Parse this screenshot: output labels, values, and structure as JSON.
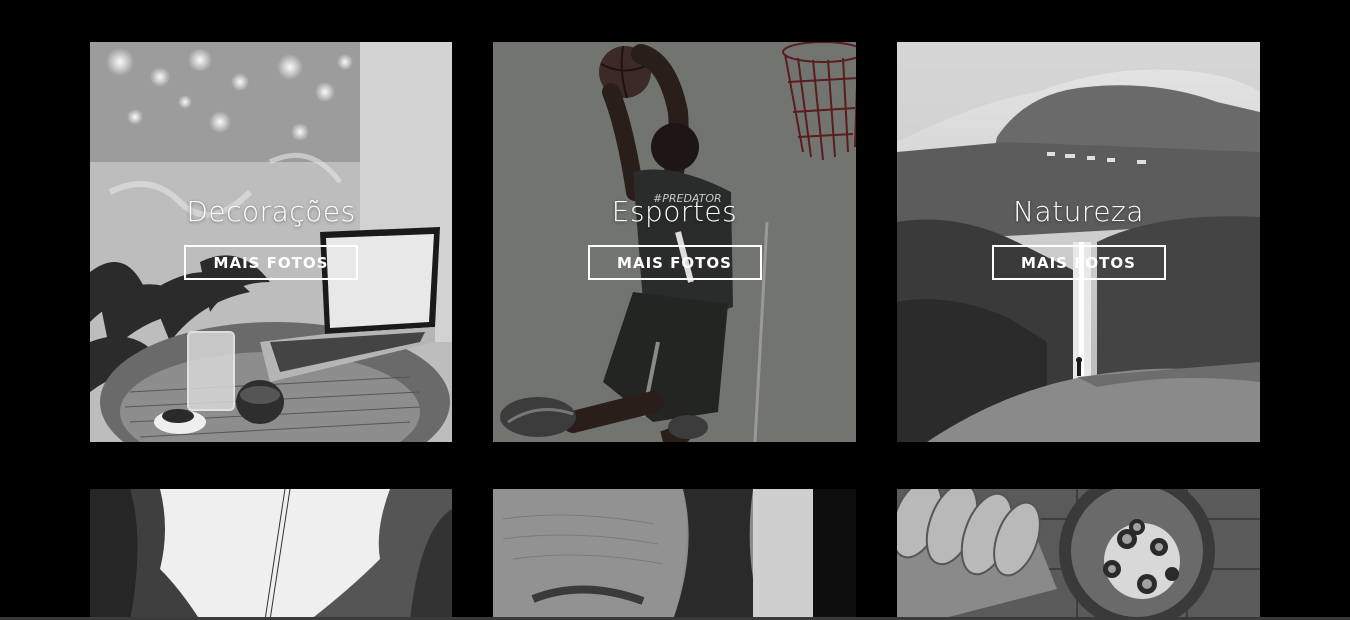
{
  "gallery": {
    "tiles": [
      {
        "title": "Decorações",
        "button_label": "MAIS FOTOS",
        "image": "cafe-laptop-photo"
      },
      {
        "title": "Esportes",
        "button_label": "MAIS FOTOS",
        "image": "basketball-player-photo"
      },
      {
        "title": "Natureza",
        "button_label": "MAIS FOTOS",
        "image": "waterfall-cliff-photo"
      },
      {
        "title": "",
        "button_label": "",
        "image": "misty-forest-photo"
      },
      {
        "title": "",
        "button_label": "",
        "image": "face-closeup-photo"
      },
      {
        "title": "",
        "button_label": "",
        "image": "food-bread-bowl-photo"
      }
    ]
  },
  "colors": {
    "background": "#000000",
    "overlay_text": "#ffffff"
  }
}
